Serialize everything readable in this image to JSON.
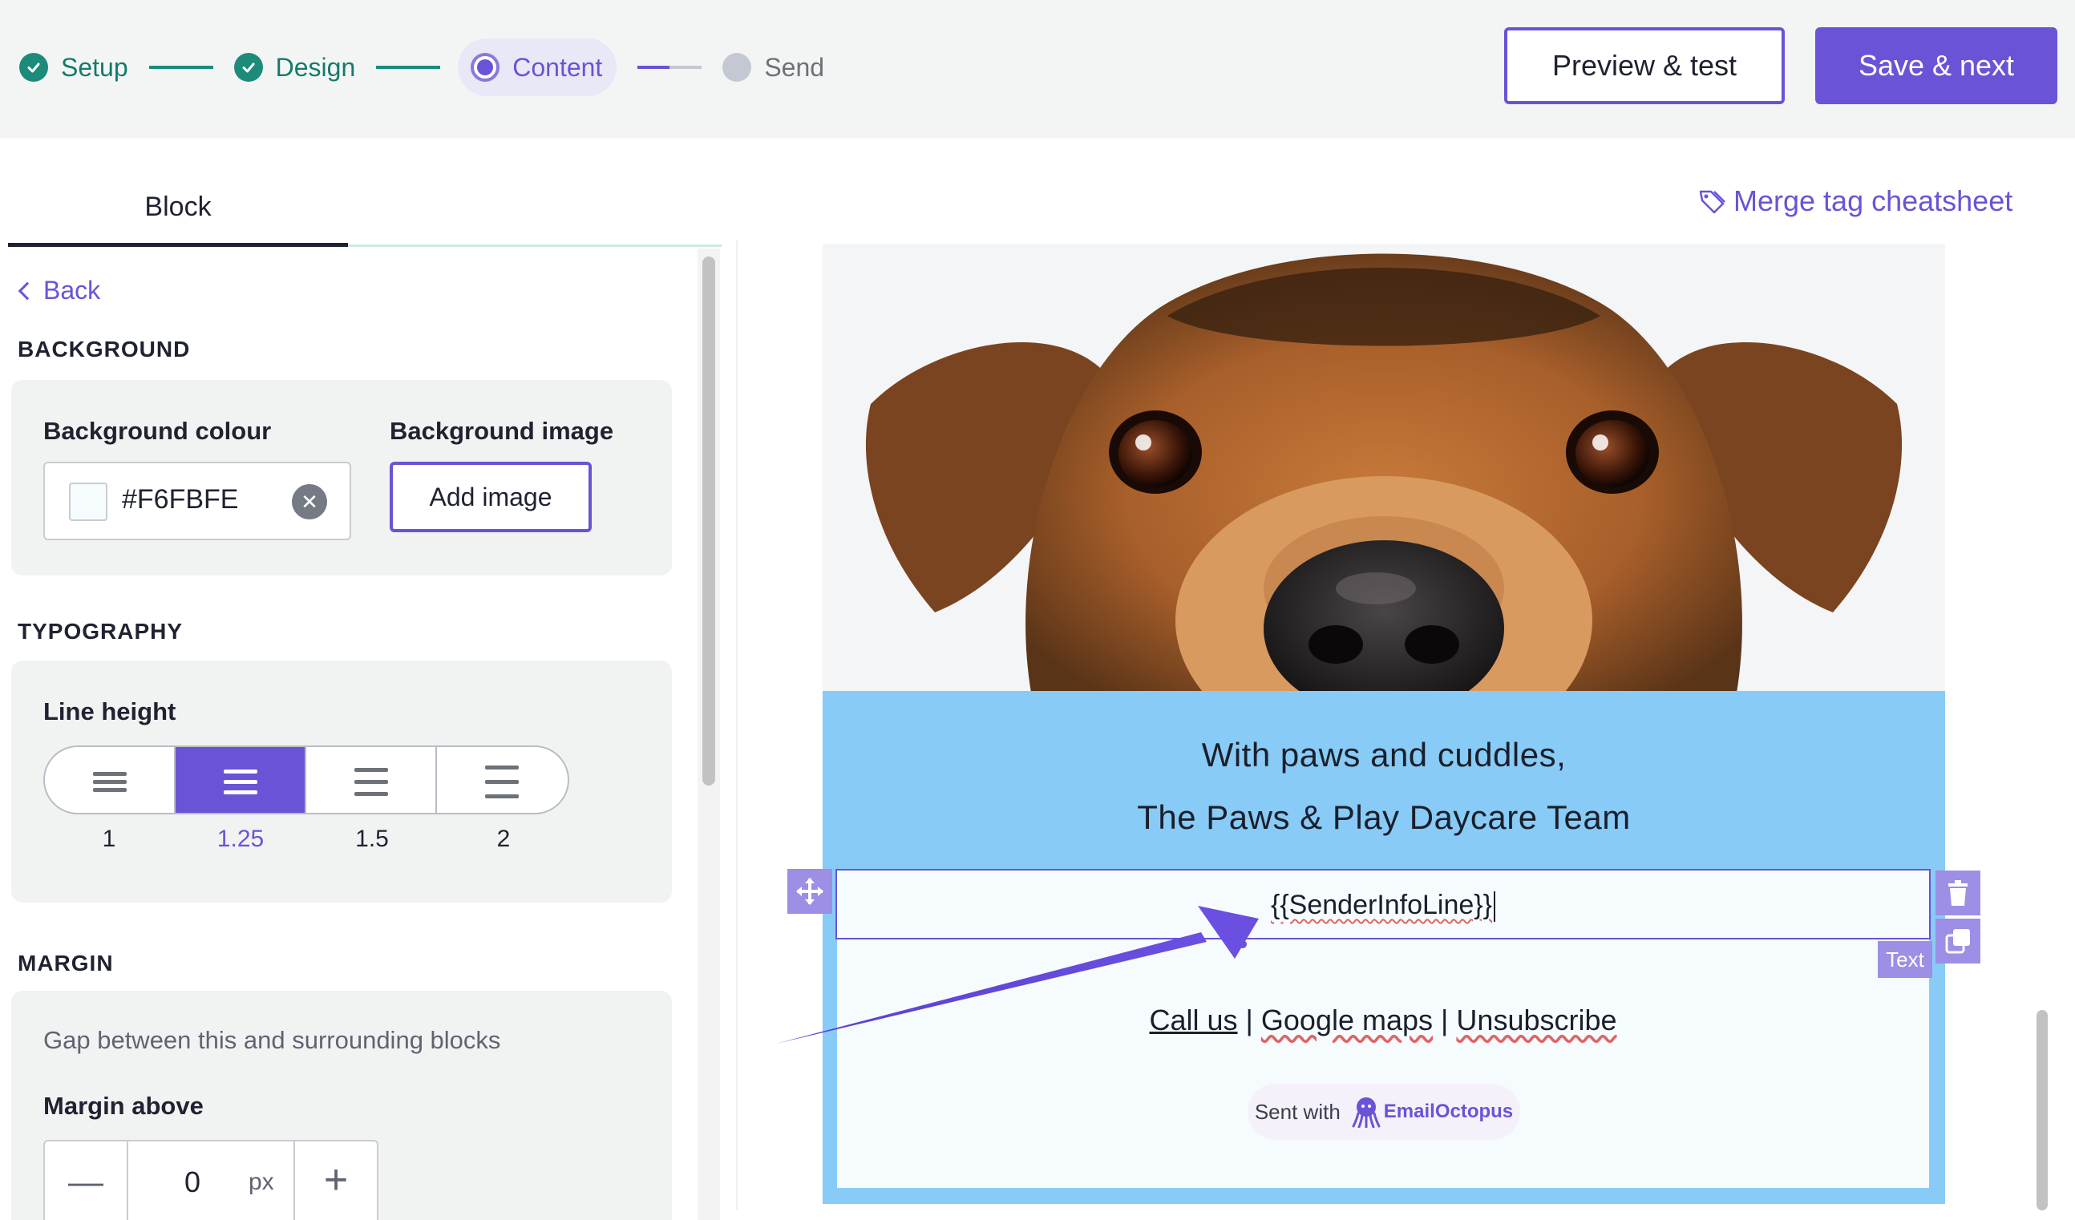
{
  "header": {
    "steps": [
      {
        "label": "Setup",
        "state": "done"
      },
      {
        "label": "Design",
        "state": "done"
      },
      {
        "label": "Content",
        "state": "active"
      },
      {
        "label": "Send",
        "state": "todo"
      }
    ],
    "preview_label": "Preview & test",
    "save_label": "Save & next"
  },
  "panel": {
    "tab_label": "Block",
    "back_label": "Back",
    "background": {
      "section": "BACKGROUND",
      "colour_label": "Background colour",
      "colour_value": "#F6FBFE",
      "image_label": "Background image",
      "add_image_label": "Add image"
    },
    "typography": {
      "section": "TYPOGRAPHY",
      "line_height_label": "Line height",
      "options": [
        "1",
        "1.25",
        "1.5",
        "2"
      ],
      "selected": "1.25"
    },
    "margin": {
      "section": "MARGIN",
      "helper": "Gap between this and surrounding blocks",
      "above_label": "Margin above",
      "above_value": "0",
      "unit": "px"
    }
  },
  "editor": {
    "merge_cheatsheet_label": "Merge tag cheatsheet",
    "signoff_line1": "With paws and cuddles,",
    "signoff_line2": "The Paws & Play Daycare Team",
    "merge_tag": "{{SenderInfoLine}}",
    "block_type": "Text",
    "links": {
      "call": "Call us",
      "maps": "Google maps",
      "unsubscribe": "Unsubscribe",
      "separator": "|"
    },
    "sent_with": "Sent with",
    "brand": "EmailOctopus"
  },
  "colors": {
    "accent": "#6a53d6",
    "success": "#1c8b7a",
    "footer_bg": "#88cbf6",
    "block_bg": "#F6FBFE"
  },
  "icons": [
    "check-icon",
    "radio-dot-icon",
    "tag-icon",
    "chevron-left-icon",
    "close-icon",
    "line-height-icon",
    "minus-icon",
    "plus-icon",
    "move-icon",
    "trash-icon",
    "duplicate-icon",
    "octopus-logo-icon"
  ]
}
